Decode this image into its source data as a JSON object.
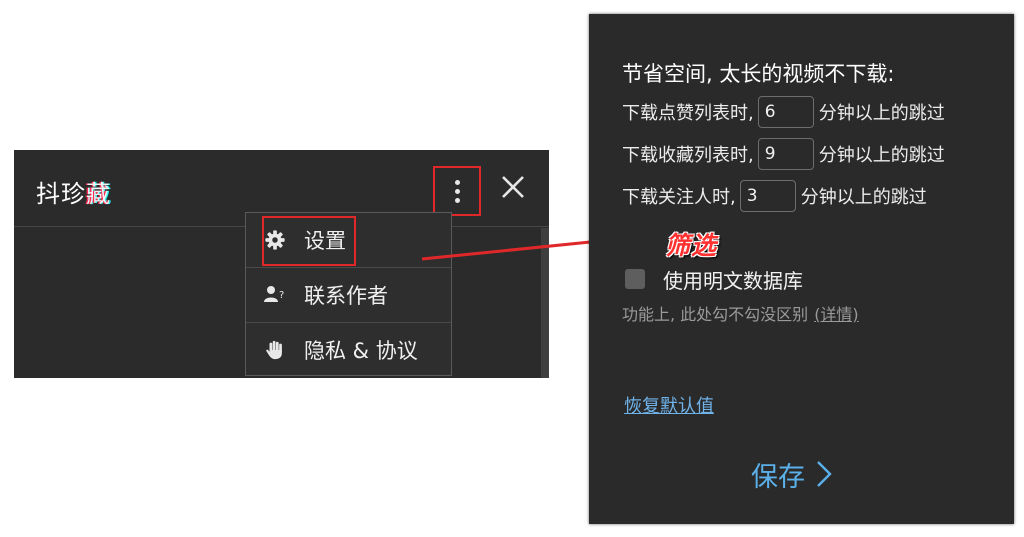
{
  "popup": {
    "title_main": "抖珍",
    "title_accent": "藏",
    "menu": [
      {
        "label": "设置",
        "icon": "gear-icon"
      },
      {
        "label": "联系作者",
        "icon": "contact-user-icon"
      },
      {
        "label": "隐私 & 协议",
        "icon": "hand-icon"
      }
    ]
  },
  "settings": {
    "heading": "节省空间, 太长的视频不下载:",
    "rows": [
      {
        "prefix": "下载点赞列表时,",
        "value": "6",
        "suffix": "分钟以上的跳过"
      },
      {
        "prefix": "下载收藏列表时,",
        "value": "9",
        "suffix": "分钟以上的跳过"
      },
      {
        "prefix": "下载关注人时,",
        "value": "3",
        "suffix": "分钟以上的跳过"
      }
    ],
    "annotation": "筛选",
    "plain_db_label": "使用明文数据库",
    "plain_db_checked": false,
    "hint_text": "功能上, 此处勾不勾没区别",
    "hint_link": "(详情)",
    "restore_label": "恢复默认值",
    "save_label": "保存"
  },
  "colors": {
    "panel_bg": "#2a2a2a",
    "highlight_red": "#e0282a",
    "link_blue": "#6fb3ea",
    "save_blue": "#5bb0ea"
  }
}
